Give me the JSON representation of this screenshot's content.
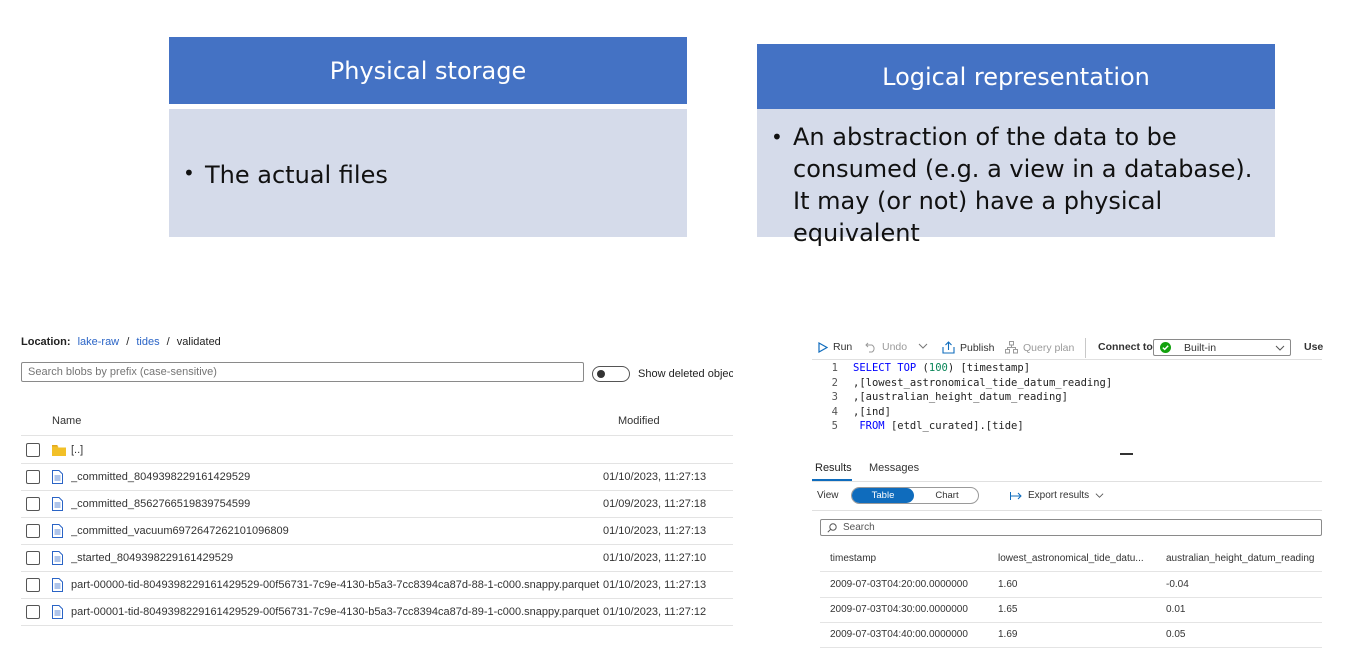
{
  "cards": {
    "physical": {
      "title": "Physical storage",
      "bullets": [
        "The actual files"
      ]
    },
    "logical": {
      "title": "Logical representation",
      "bullets": [
        "An abstraction of the data to be consumed (e.g. a view in a database). It may (or not) have a physical equivalent"
      ]
    }
  },
  "storage": {
    "location_label": "Location:",
    "breadcrumb": [
      "lake-raw",
      "tides",
      "validated"
    ],
    "separator": "/",
    "search_placeholder": "Search blobs by prefix (case-sensitive)",
    "toggle_label": "Show deleted objects",
    "columns": {
      "name": "Name",
      "modified": "Modified"
    },
    "rows": [
      {
        "name": "[..]",
        "modified": "",
        "type": "folder"
      },
      {
        "name": "_committed_8049398229161429529",
        "modified": "01/10/2023, 11:27:13",
        "type": "file"
      },
      {
        "name": "_committed_8562766519839754599",
        "modified": "01/09/2023, 11:27:18",
        "type": "file"
      },
      {
        "name": "_committed_vacuum6972647262101096809",
        "modified": "01/10/2023, 11:27:13",
        "type": "file"
      },
      {
        "name": "_started_8049398229161429529",
        "modified": "01/10/2023, 11:27:10",
        "type": "file"
      },
      {
        "name": "part-00000-tid-8049398229161429529-00f56731-7c9e-4130-b5a3-7cc8394ca87d-88-1-c000.snappy.parquet",
        "modified": "01/10/2023, 11:27:13",
        "type": "file"
      },
      {
        "name": "part-00001-tid-8049398229161429529-00f56731-7c9e-4130-b5a3-7cc8394ca87d-89-1-c000.snappy.parquet",
        "modified": "01/10/2023, 11:27:12",
        "type": "file"
      }
    ]
  },
  "query": {
    "toolbar": {
      "run": "Run",
      "undo": "Undo",
      "publish": "Publish",
      "query_plan": "Query plan",
      "connect_to": "Connect to",
      "connection": "Built-in",
      "use": "Use"
    },
    "lines": [
      {
        "n": "1",
        "parts": [
          [
            "kw",
            "SELECT TOP "
          ],
          [
            "p",
            "("
          ],
          [
            "num",
            "100"
          ],
          [
            "p",
            ") [timestamp]"
          ]
        ]
      },
      {
        "n": "2",
        "parts": [
          [
            "p",
            ",[lowest_astronomical_tide_datum_reading]"
          ]
        ]
      },
      {
        "n": "3",
        "parts": [
          [
            "p",
            ",[australian_height_datum_reading]"
          ]
        ]
      },
      {
        "n": "4",
        "parts": [
          [
            "p",
            ",[ind]"
          ]
        ]
      },
      {
        "n": "5",
        "parts": [
          [
            "kw",
            " FROM "
          ],
          [
            "p",
            "[etdl_curated].[tide]"
          ]
        ]
      }
    ],
    "tabs": {
      "results": "Results",
      "messages": "Messages"
    },
    "view_label": "View",
    "view_table": "Table",
    "view_chart": "Chart",
    "export": "Export results",
    "search_placeholder": "Search",
    "columns": [
      "timestamp",
      "lowest_astronomical_tide_datu...",
      "australian_height_datum_reading"
    ],
    "rows": [
      [
        "2009-07-03T04:20:00.0000000",
        "1.60",
        "-0.04"
      ],
      [
        "2009-07-03T04:30:00.0000000",
        "1.65",
        "0.01"
      ],
      [
        "2009-07-03T04:40:00.0000000",
        "1.69",
        "0.05"
      ]
    ]
  },
  "colors": {
    "card_header": "#4472c4",
    "card_body": "#d5dbea",
    "accent": "#0f6cbd",
    "link": "#2a64c6"
  }
}
